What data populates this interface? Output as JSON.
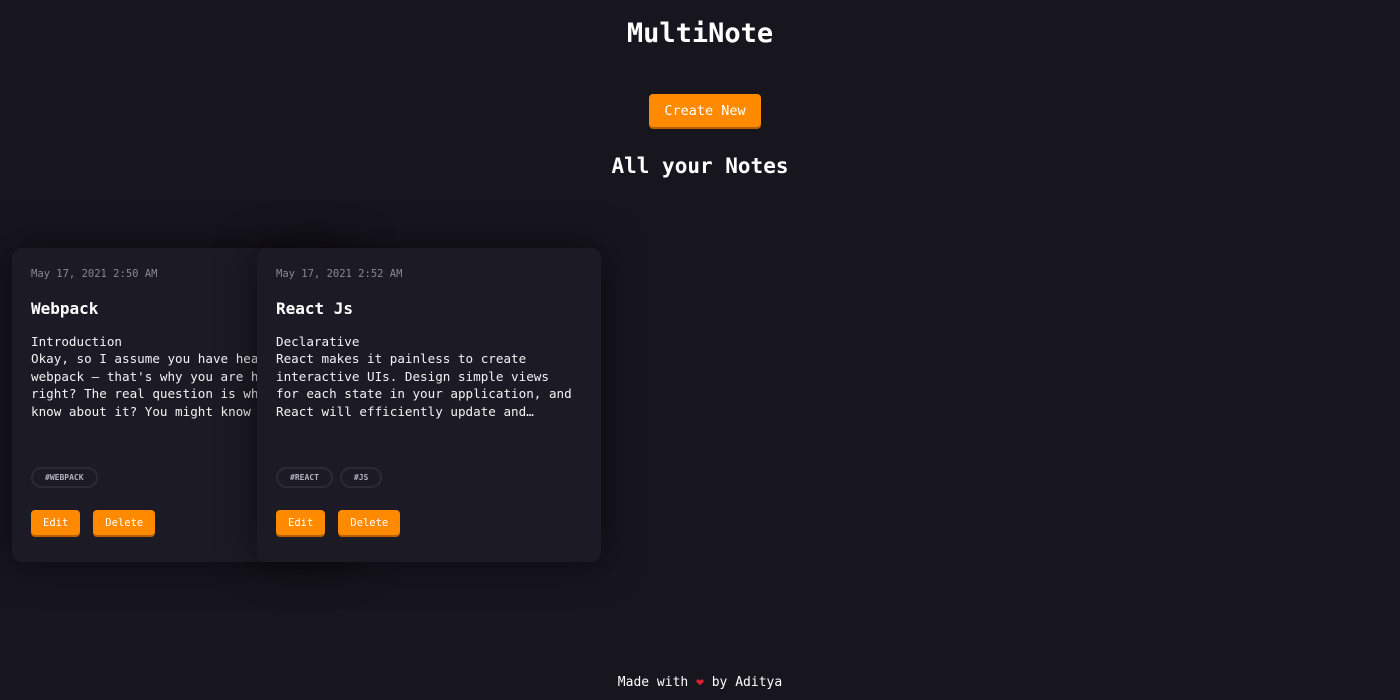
{
  "app": {
    "title": "MultiNote"
  },
  "toolbar": {
    "create_label": "Create New"
  },
  "section": {
    "title": "All your Notes"
  },
  "notes": [
    {
      "date": "May 17, 2021 2:50 AM",
      "title": "Webpack",
      "body": "Introduction\nOkay, so I assume you have heard of\nwebpack — that's why you are here,\nright? The real question is what do you\nknow about it? You might know",
      "tags": [
        "#WEBPACK"
      ],
      "edit_label": "Edit",
      "delete_label": "Delete"
    },
    {
      "date": "May 17, 2021 2:52 AM",
      "title": "React Js",
      "body": "Declarative\nReact makes it painless to create\ninteractive UIs. Design simple views\nfor each state in your application, and\nReact will efficiently update and…",
      "tags": [
        "#REACT",
        "#JS"
      ],
      "edit_label": "Edit",
      "delete_label": "Delete"
    }
  ],
  "footer": {
    "prefix": "Made with",
    "icon": "heart-icon",
    "suffix": "by Aditya"
  },
  "colors": {
    "background": "#17151e",
    "card": "#1c1a24",
    "accent": "#ff8a00",
    "heart": "#e0202e"
  }
}
